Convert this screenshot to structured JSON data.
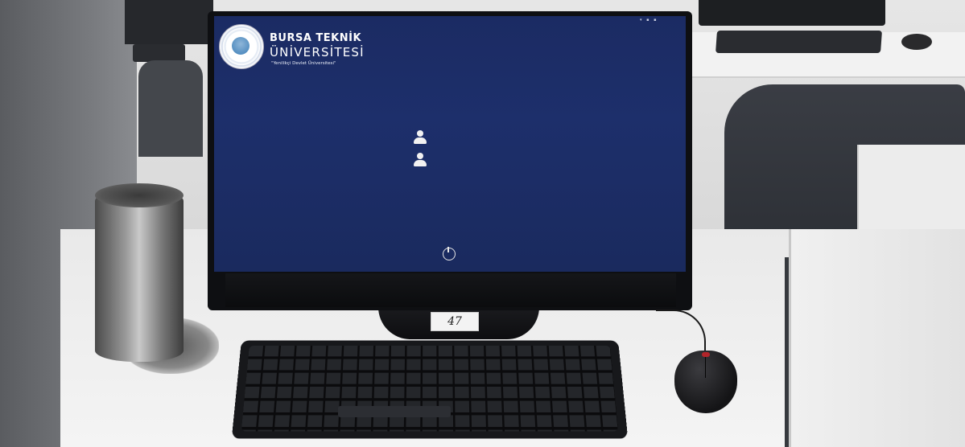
{
  "screen": {
    "university_name_line1": "BURSA TEKNİK",
    "university_name_line2": "ÜNİVERSİTESİ",
    "university_slogan": "\"Yenilikçi Devlet Üniversitesi\"",
    "clock": "",
    "users": [
      {
        "name": ""
      },
      {
        "name": ""
      }
    ],
    "background_color": "#1c2d66"
  },
  "desk": {
    "seat_tag": "47"
  },
  "icons": {
    "logo": "university-seal-icon",
    "avatar": "user-avatar-icon",
    "power": "power-icon"
  }
}
